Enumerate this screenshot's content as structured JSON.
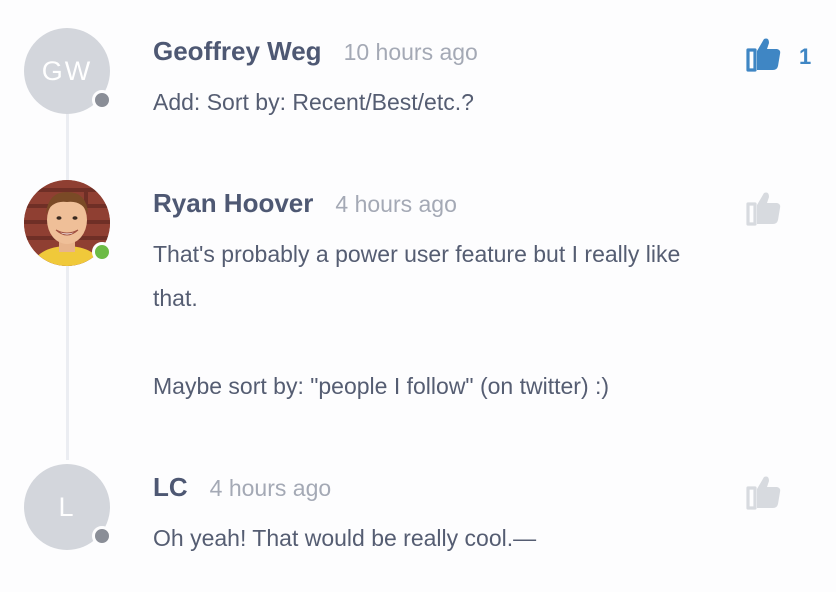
{
  "colors": {
    "accent": "#3f86c4",
    "author": "#4e5873",
    "muted": "#a4a9b5",
    "online": "#6cbb45",
    "offline": "#8a8e97",
    "thumb_inactive": "#d7dadf"
  },
  "comments": [
    {
      "avatar_initials": "GW",
      "status": "offline",
      "author": "Geoffrey Weg",
      "time": "10 hours ago",
      "paragraphs": [
        "Add: Sort by: Recent/Best/etc.?"
      ],
      "upvote_icon": "thumbs-up-icon",
      "upvoted": true,
      "upvote_count": "1"
    },
    {
      "avatar_initials": "",
      "status": "online",
      "author": "Ryan Hoover",
      "time": "4 hours ago",
      "paragraphs": [
        "That's probably a power user feature but I really like that.",
        "Maybe sort by: \"people I follow\" (on twitter) :)"
      ],
      "upvote_icon": "thumbs-up-icon",
      "upvoted": false,
      "upvote_count": ""
    },
    {
      "avatar_initials": "L",
      "status": "offline",
      "author": "LC",
      "time": "4 hours ago",
      "paragraphs": [
        "Oh yeah! That would be really cool.—"
      ],
      "upvote_icon": "thumbs-up-icon",
      "upvoted": false,
      "upvote_count": ""
    }
  ]
}
